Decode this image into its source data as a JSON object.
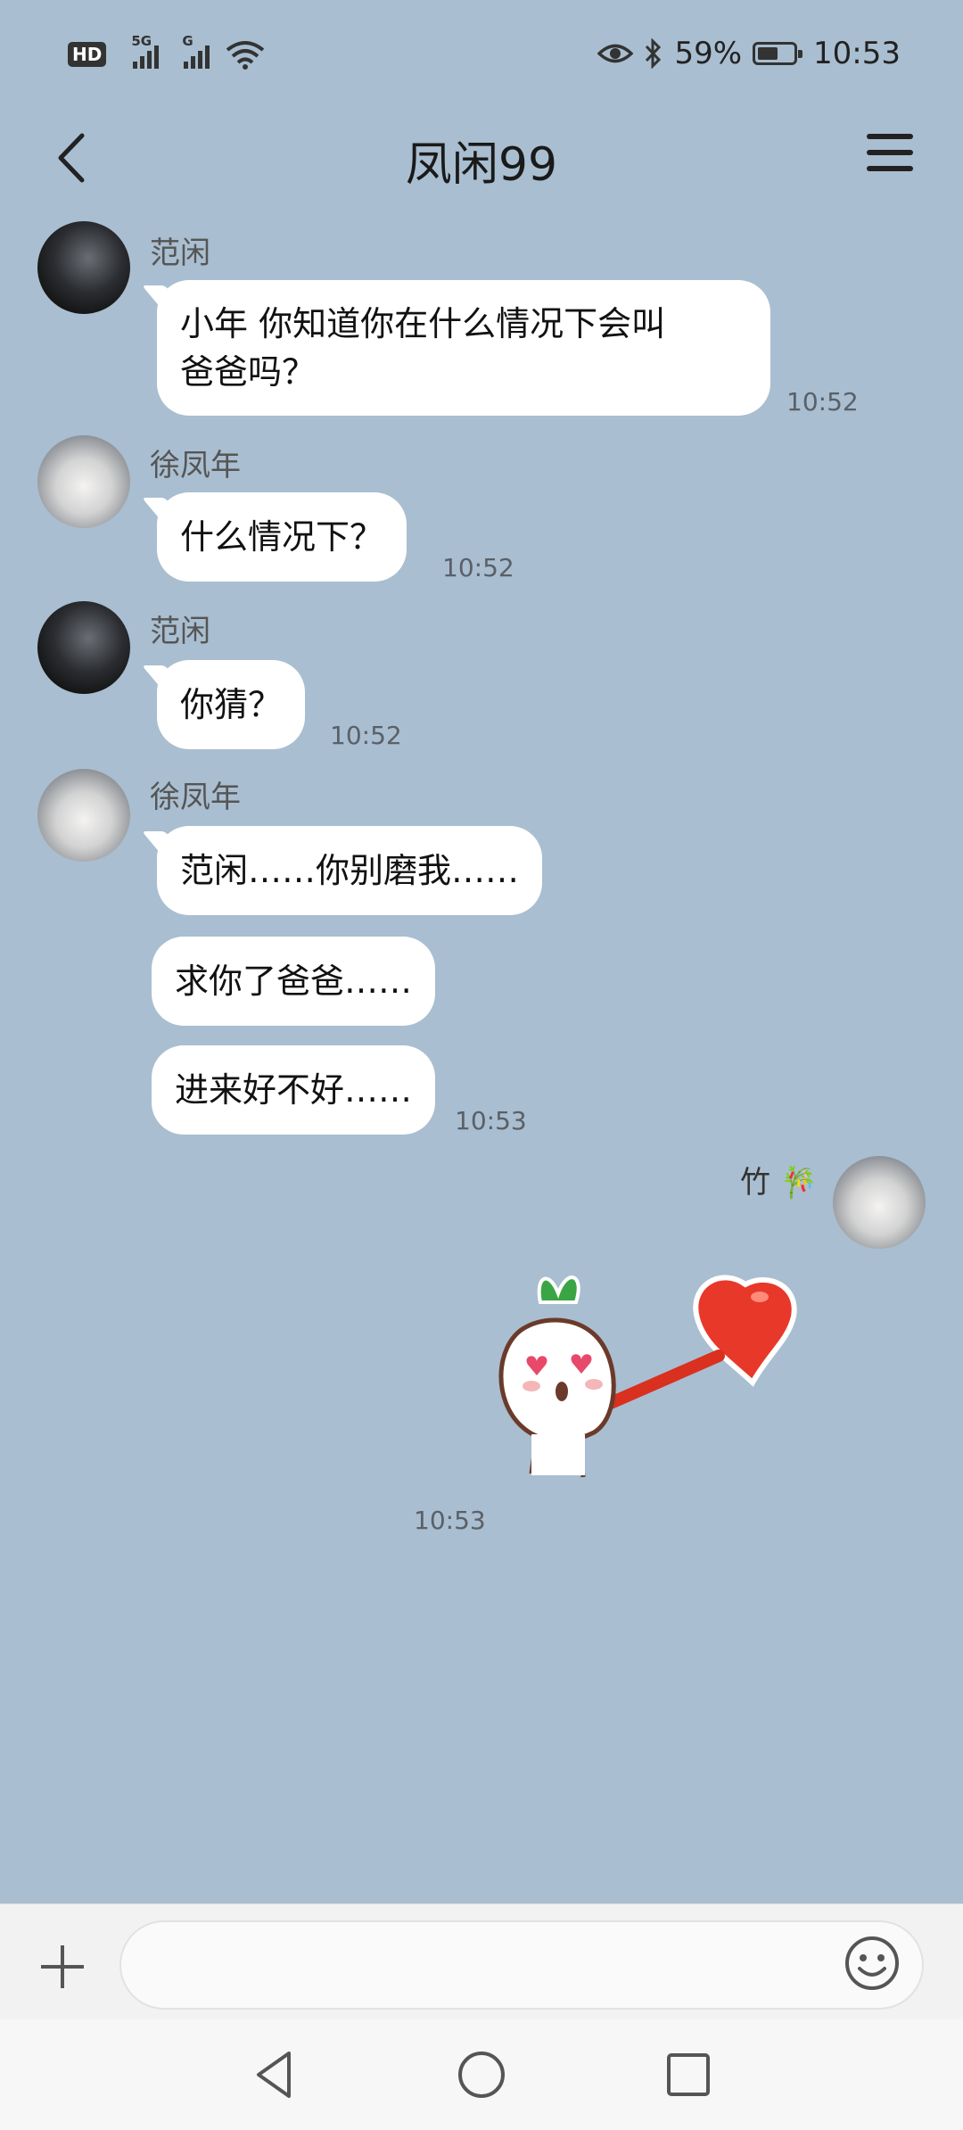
{
  "status": {
    "signal_5g": "5G",
    "signal_g": "G",
    "hd": "HD",
    "battery_text": "59%",
    "battery_level": 0.59,
    "time": "10:53"
  },
  "header": {
    "title": "凤闲99"
  },
  "messages": [
    {
      "sender": "范闲",
      "text_line1": "小年 你知道你在什么情况下会叫",
      "text_line2": "爸爸吗？",
      "time": "10:52"
    },
    {
      "sender": "徐凤年",
      "text": "什么情况下？",
      "time": "10:52"
    },
    {
      "sender": "范闲",
      "text": "你猜？",
      "time": "10:52"
    },
    {
      "sender": "徐凤年",
      "bubbles": [
        {
          "pre": "范闲……",
          "mid": "你别磨我",
          "post": "……"
        },
        {
          "pre": "求你",
          "mid": "了爸爸……"
        },
        {
          "pre": "进来",
          "mid": "好不好……"
        }
      ],
      "time": "10:53"
    }
  ],
  "self": {
    "name": "竹",
    "name_emoji": "🎋",
    "sticker_time": "10:53",
    "sticker_icon": "radish-heart-sticker"
  },
  "input": {
    "placeholder": ""
  },
  "colors": {
    "background": "#a9bed0",
    "bubble": "#ffffff",
    "accent_heart": "#e8382a"
  }
}
